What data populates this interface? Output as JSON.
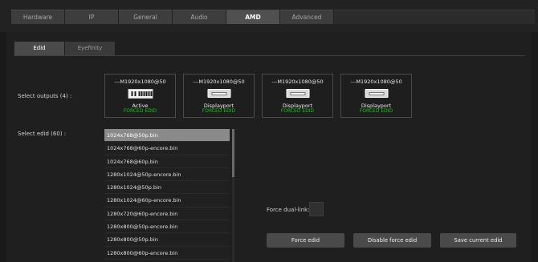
{
  "tabs": [
    {
      "label": "Hardware"
    },
    {
      "label": "IP"
    },
    {
      "label": "General"
    },
    {
      "label": "Audio"
    },
    {
      "label": "AMD",
      "active": true
    },
    {
      "label": "Advanced"
    }
  ],
  "subtabs": [
    {
      "label": "Edid",
      "active": true
    },
    {
      "label": "Eyefinity"
    }
  ],
  "outputs_label": "Select outputs (4) :",
  "edid_label": "Select edid (60) :",
  "outputs": [
    {
      "resolution": "---M1920x1080@50",
      "name": "Active",
      "status": "FORCED EDID",
      "icon": "hdmi-port-icon"
    },
    {
      "resolution": "---M1920x1080@50",
      "name": "Displayport",
      "status": "FORCED EDID",
      "icon": "displayport-icon"
    },
    {
      "resolution": "---M1920x1080@50",
      "name": "Displayport",
      "status": "FORCED EDID",
      "icon": "displayport-icon"
    },
    {
      "resolution": "---M1920x1080@50",
      "name": "Displayport",
      "status": "FORCED EDID",
      "icon": "displayport-icon"
    }
  ],
  "edid_list": [
    "1024x768@50p.bin",
    "1024x768@60p-encore.bin",
    "1024x768@60p.bin",
    "1280x1024@50p-encore.bin",
    "1280x1024@50p.bin",
    "1280x1024@60p-encore.bin",
    "1280x720@60p-encore.bin",
    "1280x800@50p-encore.bin",
    "1280x800@50p.bin",
    "1280x800@60p-encore.bin"
  ],
  "selected_edid": "1024x768@50p.bin",
  "force_dual_link_label": "Force dual-link:",
  "buttons": {
    "force_edid": "Force edid",
    "disable_force_edid": "Disable force edid",
    "save_current_edid": "Save current edid"
  },
  "colors": {
    "background": "#1a1a1a",
    "status_green": "#18c418",
    "button": "#4a4a4a",
    "selected_row": "#8a8a8a"
  }
}
